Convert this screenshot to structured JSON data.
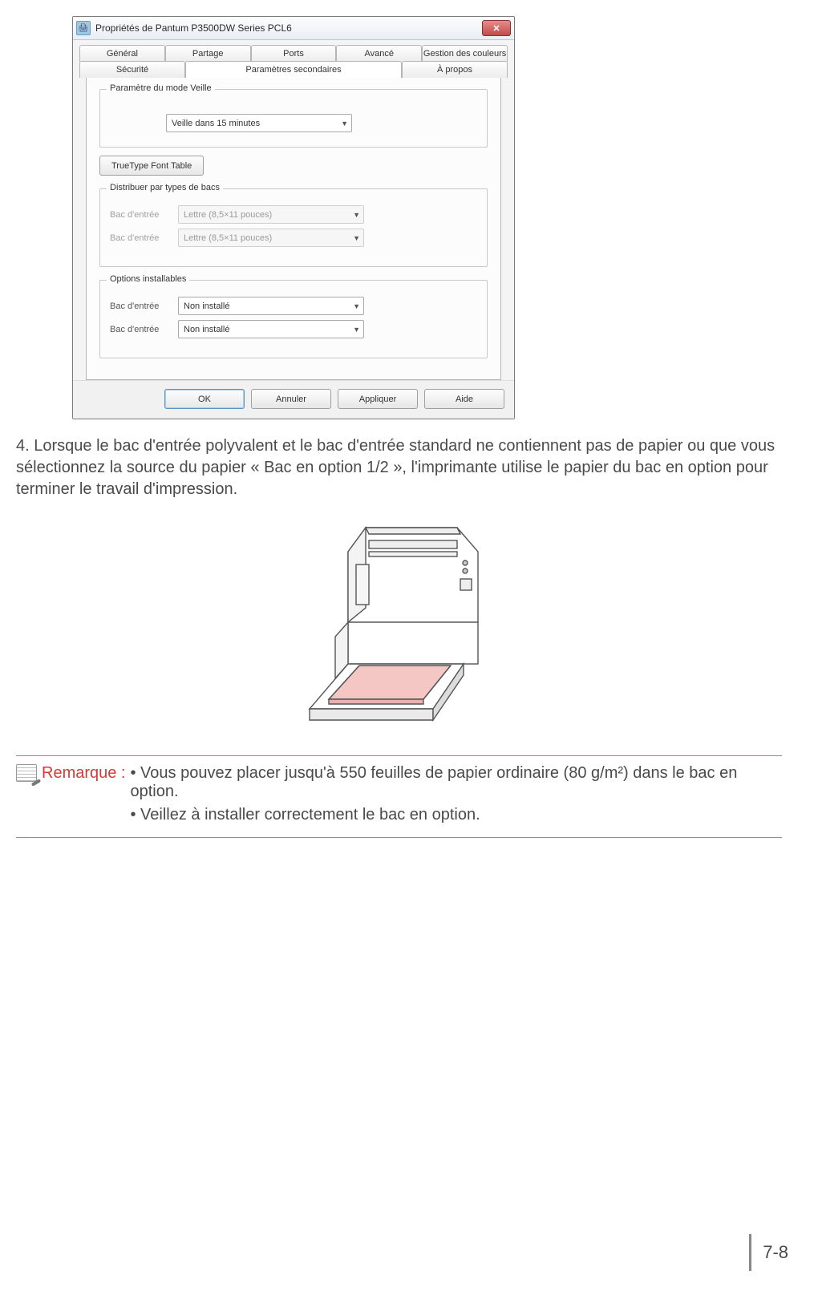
{
  "dialog": {
    "title": "Propriétés de Pantum P3500DW Series PCL6",
    "tabs_row1": [
      "Général",
      "Partage",
      "Ports",
      "Avancé",
      "Gestion des couleurs"
    ],
    "tabs_row2": [
      "Sécurité",
      "Paramètres secondaires",
      "À propos"
    ],
    "group_sleep": {
      "legend": "Paramètre du mode Veille",
      "value": "Veille dans 15 minutes"
    },
    "truetype_btn": "TrueType Font Table",
    "group_trays": {
      "legend": "Distribuer par types de bacs",
      "rows": [
        {
          "label": "Bac d'entrée",
          "value": "Lettre (8,5×11 pouces)"
        },
        {
          "label": "Bac d'entrée",
          "value": "Lettre (8,5×11 pouces)"
        }
      ]
    },
    "group_options": {
      "legend": "Options installables",
      "rows": [
        {
          "label": "Bac d'entrée",
          "value": "Non installé"
        },
        {
          "label": "Bac d'entrée",
          "value": "Non installé"
        }
      ]
    },
    "buttons": {
      "ok": "OK",
      "cancel": "Annuler",
      "apply": "Appliquer",
      "help": "Aide"
    }
  },
  "body_paragraph": "4. Lorsque le bac d'entrée polyvalent et le bac d'entrée standard ne contiennent pas de papier ou que vous sélectionnez la source du papier « Bac en option 1/2 », l'imprimante utilise le papier du bac en option pour terminer le travail d'impression.",
  "note": {
    "label": "Remarque :",
    "bullets": [
      "• Vous pouvez placer jusqu'à 550 feuilles de papier ordinaire (80 g/m²) dans le bac en option.",
      "• Veillez à installer correctement le bac en option."
    ]
  },
  "page_number": "7-8"
}
